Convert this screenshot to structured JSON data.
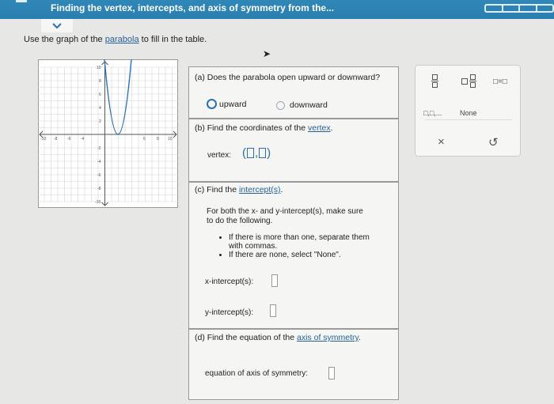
{
  "header": {
    "title": "Finding the vertex, intercepts, and axis of symmetry from the...",
    "progress_segments": 4
  },
  "instruction": {
    "prefix": "Use the graph of the",
    "link": "parabola",
    "suffix": "to fill in the table."
  },
  "graph": {
    "x_ticks": [
      "-10",
      "-8",
      "-6",
      "-4",
      "6",
      "8",
      "10"
    ],
    "y_ticks": [
      "10",
      "8",
      "6",
      "4",
      "2",
      "-2",
      "-4",
      "-6",
      "-8",
      "-10"
    ]
  },
  "part_a": {
    "question": "(a) Does the parabola open upward or downward?",
    "option_upward": "upward",
    "option_downward": "downward"
  },
  "part_b": {
    "prefix": "(b) Find the coordinates of the",
    "link": "vertex",
    "suffix": ".",
    "vertex_label": "vertex:"
  },
  "part_c": {
    "prefix": "(c) Find the",
    "link": "intercept(s)",
    "suffix": ".",
    "instructions_line1": "For both the x- and y-intercept(s), make sure",
    "instructions_line2": "to do the following.",
    "bullet1_line1": "If there is more than one, separate them",
    "bullet1_line2": "with commas.",
    "bullet2": "If there are none, select \"None\".",
    "x_intercept_label": "x-intercept(s):",
    "y_intercept_label": "y-intercept(s):"
  },
  "part_d": {
    "prefix": "(d) Find the equation of the",
    "link": "axis of symmetry",
    "suffix": ".",
    "label": "equation of axis of symmetry:"
  },
  "toolbox": {
    "comma_tool": "□,□,...",
    "none_tool": "None",
    "equals_tool": "□=□",
    "clear_symbol": "×",
    "undo_symbol": "↺"
  }
}
